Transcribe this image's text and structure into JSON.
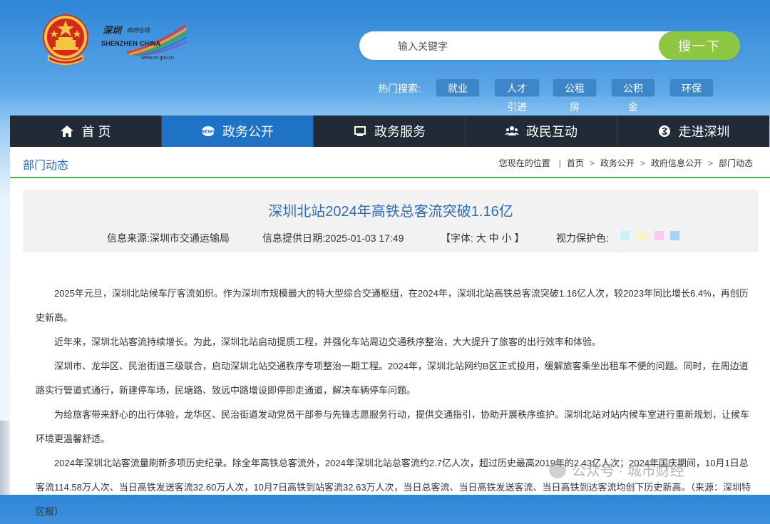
{
  "header": {
    "logo": {
      "cn_main": "深圳",
      "cn_sub": "政府在线",
      "en": "SHENZHEN CHINA",
      "url": "www.sz.gov.cn"
    },
    "search": {
      "placeholder": "输入关键字",
      "button_label": "搜一下"
    },
    "hot_search": {
      "label": "热门搜索:",
      "tags": [
        "就业",
        "人才引进",
        "公租房",
        "公积金",
        "环保"
      ]
    }
  },
  "nav": {
    "items": [
      {
        "label": "首 页",
        "icon": "home-icon"
      },
      {
        "label": "政务公开",
        "icon": "news-icon"
      },
      {
        "label": "政务服务",
        "icon": "monitor-icon"
      },
      {
        "label": "政民互动",
        "icon": "people-icon"
      },
      {
        "label": "走进深圳",
        "icon": "info-icon"
      }
    ],
    "active_index": 1
  },
  "breadcrumb": {
    "section_title": "部门动态",
    "lead": "您现在的位置",
    "items": [
      "首页",
      "政务公开",
      "政府信息公开",
      "部门动态"
    ]
  },
  "article": {
    "title": "深圳北站2024年高铁总客流突破1.16亿",
    "source": "信息来源:深圳市交通运输局",
    "date": "信息提供日期:2025-01-03 17:49",
    "font_size": "【字体: 大 中 小 】",
    "eye_care_label": "视力保护色:",
    "eye_care_colors": [
      "#ccf0f8",
      "#fbf3c4",
      "#f8c8f4",
      "#a8d2f6"
    ],
    "paragraphs": [
      "2025年元旦，深圳北站候车厅客流如织。作为深圳市规模最大的特大型综合交通枢纽，在2024年，深圳北站高铁总客流突破1.16亿人次，较2023年同比增长6.4%，再创历史新高。",
      "近年来，深圳北站客流持续增长。为此，深圳北站启动提质工程，并强化车站周边交通秩序整治，大大提升了旅客的出行效率和体验。",
      "深圳市、龙华区、民治街道三级联合，启动深圳北站交通秩序专项整治一期工程。2024年，深圳北站网约B区正式投用，缓解旅客乘坐出租车不便的问题。同时，在周边道路实行管道式通行，新建停车场，民塘路、致远中路增设即停即走通道，解决车辆停车问题。",
      "为给旅客带来舒心的出行体验，龙华区、民治街道发动党员干部参与先锋志愿服务行动，提供交通指引，协助开展秩序维护。深圳北站对站内候车室进行重新规划，让候车环境更温馨舒适。",
      "2024年深圳北站客流量刷新多项历史纪录。除全年高铁总客流外，2024年深圳北站总客流约2.7亿人次，超过历史最高2019年的2.43亿人次；2024年国庆期间，10月1日总客流114.58万人次、当日高铁发送客流32.60万人次，10月7日高铁到站客流32.63万人次，当日总客流、当日高铁发送客流、当日高铁到达客流均创下历史新高。（来源：深圳特区报）"
    ]
  },
  "watermark": {
    "text": "公众号 · 城市财经"
  },
  "colors": {
    "nav_bg": "#222a36",
    "nav_active": "#1e73c7",
    "search_button": "#8dc640",
    "title_blue": "#2b6db5",
    "accent_green": "#3dbb63"
  }
}
